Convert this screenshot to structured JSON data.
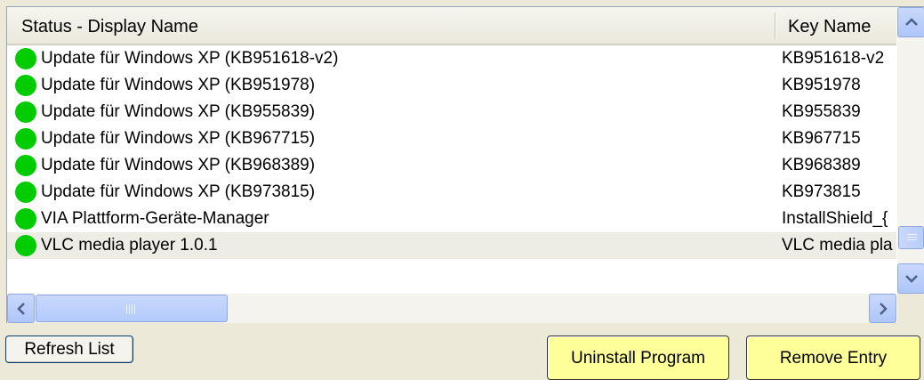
{
  "list": {
    "columns": [
      "Status - Display Name",
      "Key Name"
    ],
    "rows": [
      {
        "status": "green",
        "name": "Update für Windows XP (KB951618-v2)",
        "key": "KB951618-v2"
      },
      {
        "status": "green",
        "name": "Update für Windows XP (KB951978)",
        "key": "KB951978"
      },
      {
        "status": "green",
        "name": "Update für Windows XP (KB955839)",
        "key": "KB955839"
      },
      {
        "status": "green",
        "name": "Update für Windows XP (KB967715)",
        "key": "KB967715"
      },
      {
        "status": "green",
        "name": "Update für Windows XP (KB968389)",
        "key": "KB968389"
      },
      {
        "status": "green",
        "name": "Update für Windows XP (KB973815)",
        "key": "KB973815"
      },
      {
        "status": "green",
        "name": "VIA Plattform-Geräte-Manager",
        "key": "InstallShield_{"
      },
      {
        "status": "green",
        "name": "VLC media player 1.0.1",
        "key": "VLC media pla"
      }
    ],
    "selected_index": 7
  },
  "buttons": {
    "refresh": "Refresh List",
    "uninstall": "Uninstall Program",
    "remove": "Remove Entry"
  },
  "colors": {
    "status_ok": "#00cc00",
    "action_button": "#ffff99",
    "selected_row": "#eeede5"
  },
  "icons": {
    "scroll_up": "chevron-up-icon",
    "scroll_down": "chevron-down-icon",
    "scroll_left": "chevron-left-icon",
    "scroll_right": "chevron-right-icon",
    "status": "green-status-icon"
  }
}
